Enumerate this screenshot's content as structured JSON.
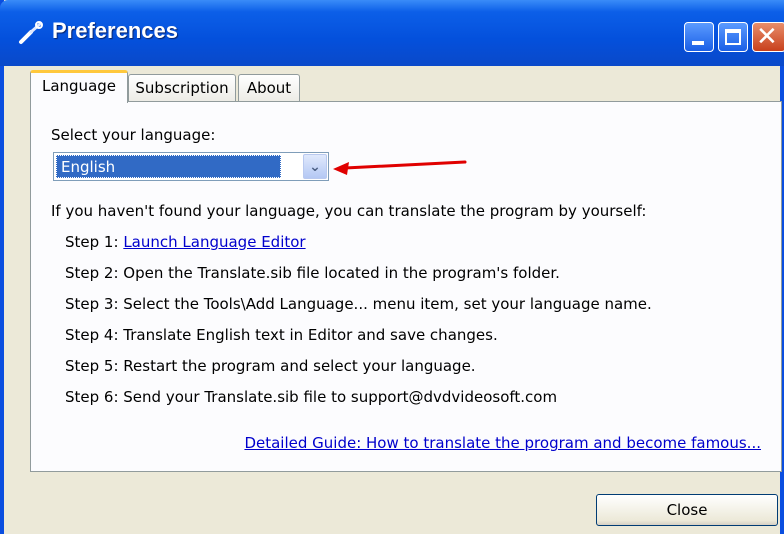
{
  "window": {
    "title": "Preferences",
    "title_icon": "wrench-icon",
    "controls": {
      "minimize": "minimize-icon",
      "maximize": "maximize-icon",
      "close": "close-icon"
    }
  },
  "tabs": [
    {
      "label": "Language",
      "active": true
    },
    {
      "label": "Subscription",
      "active": false
    },
    {
      "label": "About",
      "active": false
    }
  ],
  "language": {
    "select_label": "Select your language:",
    "selected": "English",
    "intro": "If you haven't found your language, you can translate the program by yourself:",
    "step1_prefix": "Step 1:",
    "step1_link": "Launch Language Editor",
    "steps": [
      "Step 2: Open the Translate.sib file located in the program's folder.",
      "Step 3: Select the Tools\\Add Language... menu item, set your language name.",
      "Step 4: Translate English text in Editor and save changes.",
      "Step 5: Restart the program and select your language.",
      "Step 6: Send your Translate.sib file to support@dvdvideosoft.com"
    ],
    "guide_link": "Detailed Guide: How to translate the program and become famous..."
  },
  "footer": {
    "close_label": "Close"
  },
  "colors": {
    "titlebar": "#0450dc",
    "selection": "#316ac5",
    "annotation_arrow": "#e00000"
  }
}
